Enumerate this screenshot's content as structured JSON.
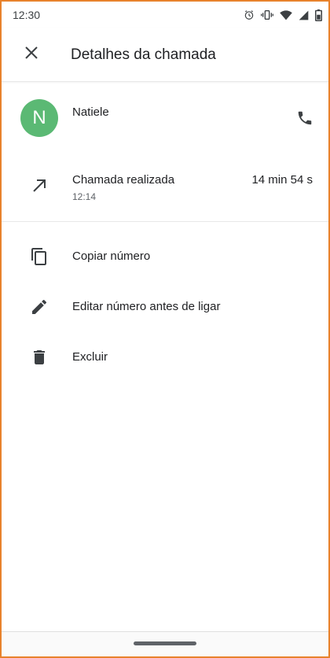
{
  "status_bar": {
    "time": "12:30",
    "icons": [
      "alarm-icon",
      "vibrate-icon",
      "wifi-icon",
      "signal-icon",
      "battery-icon"
    ]
  },
  "app_bar": {
    "close_icon": "close-icon",
    "title": "Detalhes da chamada"
  },
  "contact": {
    "initial": "N",
    "name": "Natiele",
    "avatar_color": "#5bb974",
    "call_icon": "phone-icon"
  },
  "call": {
    "icon": "outgoing-call-arrow-icon",
    "type": "Chamada realizada",
    "time": "12:14",
    "duration": "14 min 54 s"
  },
  "actions": [
    {
      "icon": "copy-icon",
      "label": "Copiar número"
    },
    {
      "icon": "edit-icon",
      "label": "Editar número antes de ligar"
    },
    {
      "icon": "trash-icon",
      "label": "Excluir"
    }
  ],
  "colors": {
    "frame_border": "#e8822c",
    "icon": "#3c4043",
    "text_primary": "#202124",
    "text_secondary": "#5f6368"
  }
}
